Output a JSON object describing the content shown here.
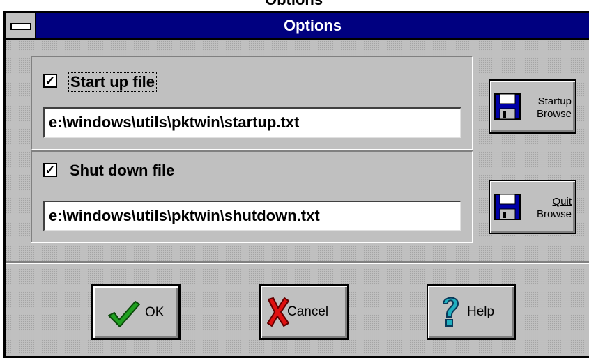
{
  "window": {
    "title": "Options"
  },
  "startup": {
    "checkbox_mark": "✓",
    "label": "Start up file",
    "path": "e:\\windows\\utils\\pktwin\\startup.txt",
    "browse_line1": "Startup",
    "browse_line2": "Browse",
    "icon": "floppy-disk-icon"
  },
  "shutdown": {
    "checkbox_mark": "✓",
    "label": "Shut down file",
    "path": "e:\\windows\\utils\\pktwin\\shutdown.txt",
    "browse_line1": "Quit",
    "browse_line2": "Browse",
    "icon": "floppy-disk-icon"
  },
  "buttons": {
    "ok": "OK",
    "cancel": "Cancel",
    "help": "Help",
    "ok_icon": "checkmark-icon",
    "cancel_icon": "red-x-icon",
    "help_icon": "question-mark-icon"
  },
  "colors": {
    "titlebar": "#000080",
    "face": "#c0c0c0",
    "ok_check": "#20a020",
    "cancel_x": "#e01010",
    "help_q": "#20b0c0",
    "disk": "#0000a8"
  }
}
